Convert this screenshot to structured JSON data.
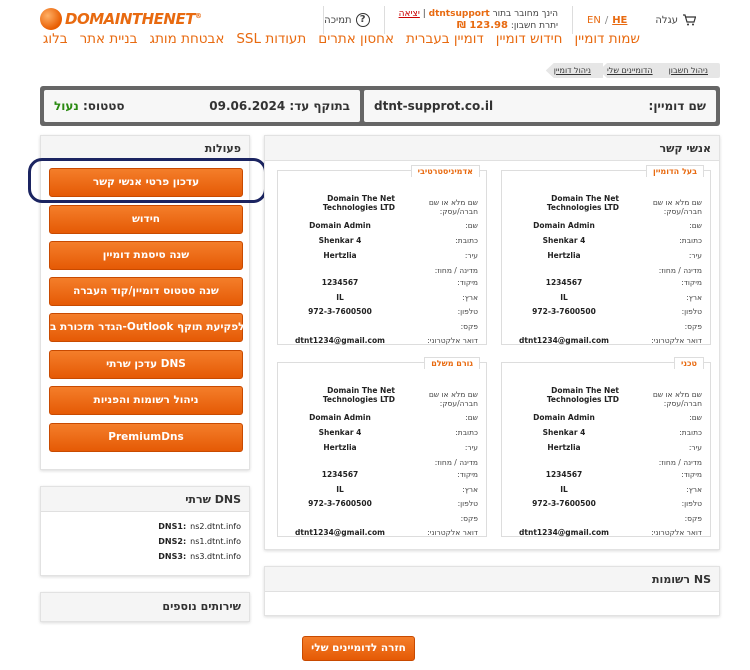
{
  "brand": {
    "logo_text": "DOMAINTHENET",
    "reg": "®"
  },
  "header": {
    "cart_label": "עגלה",
    "lang_he": "HE",
    "lang_en": "EN",
    "lang_sep": "/",
    "logged_in_as": "הינך מחובר בתור",
    "username": "dtntsupport",
    "exit_sep": "|",
    "exit_label": "יציאה",
    "balance_label": "יתרת חשבון:",
    "balance_value": "123.98 ₪",
    "support_label": "תמיכה"
  },
  "nav": [
    "שמות דומיין",
    "חידוש דומיין",
    "דומיין בעברית",
    "אחסון אתרים",
    "תעודות SSL",
    "אבטחת מותג",
    "בניית אתר",
    "בלוג"
  ],
  "breadcrumbs": [
    "ניהול חשבון",
    "הדומיינים שלי",
    "ניהול דומיין"
  ],
  "domain": {
    "name_label": "שם דומיין:",
    "name_value": "dtnt-supprot.co.il",
    "expiry_label": "בתוקף עד:",
    "expiry_value": "09.06.2024",
    "status_label": "סטטוס:",
    "status_value": "נעול"
  },
  "actions": {
    "title": "פעולות",
    "buttons": [
      "עדכון פרטי אנשי קשר",
      "חידוש",
      "שנה סיסמת דומיין",
      "שנה סטטוס דומיין/קוד העברה",
      "הגדר תזכורת ב-Outlook לפקיעת תוקף",
      "עדכן שרתי DNS",
      "ניהול רשומות והפניות",
      "PremiumDns"
    ]
  },
  "dns": {
    "title": "שרתי DNS",
    "servers": [
      {
        "label": "DNS1:",
        "value": "ns2.dtnt.info"
      },
      {
        "label": "DNS2:",
        "value": "ns1.dtnt.info"
      },
      {
        "label": "DNS3:",
        "value": "ns3.dtnt.info"
      }
    ]
  },
  "more_services": {
    "title": "שירותים נוספים"
  },
  "contacts": {
    "title": "אנשי קשר",
    "labels": {
      "fullname": "שם מלא או שם חברה/עסק:",
      "name": "שם:",
      "address": "כתובת:",
      "city": "עיר:",
      "state": "מדינה / מחוז:",
      "zip": "מיקוד:",
      "country": "ארץ:",
      "phone": "טלפון:",
      "fax": "פקס:",
      "email": "דואר אלקטרוני:"
    },
    "boxes": [
      {
        "title": "בעל הדומיין",
        "fullname": "Domain The Net Technologies LTD",
        "name": "Domain Admin",
        "address": "Shenkar 4",
        "city": "Hertzlia",
        "state": "",
        "zip": "1234567",
        "country": "IL",
        "phone": "972-3-7600500",
        "fax": "",
        "email": "dtnt1234@gmail.com"
      },
      {
        "title": "אדמיניסטרטיבי",
        "fullname": "Domain The Net Technologies LTD",
        "name": "Domain Admin",
        "address": "Shenkar 4",
        "city": "Hertzlia",
        "state": "",
        "zip": "1234567",
        "country": "IL",
        "phone": "972-3-7600500",
        "fax": "",
        "email": "dtnt1234@gmail.com"
      },
      {
        "title": "טכני",
        "fullname": "Domain The Net Technologies LTD",
        "name": "Domain Admin",
        "address": "Shenkar 4",
        "city": "Hertzlia",
        "state": "",
        "zip": "1234567",
        "country": "IL",
        "phone": "972-3-7600500",
        "fax": "",
        "email": "dtnt1234@gmail.com"
      },
      {
        "title": "גורם משלם",
        "fullname": "Domain The Net Technologies LTD",
        "name": "Domain Admin",
        "address": "Shenkar 4",
        "city": "Hertzlia",
        "state": "",
        "zip": "1234567",
        "country": "IL",
        "phone": "972-3-7600500",
        "fax": "",
        "email": "dtnt1234@gmail.com"
      }
    ]
  },
  "ns_records": {
    "title": "רשומות NS"
  },
  "back_button": "חזרה לדומיינים שלי",
  "colors": {
    "accent": "#e86a10",
    "status_green": "#2b8a12",
    "highlight_ring": "#1b2461"
  }
}
